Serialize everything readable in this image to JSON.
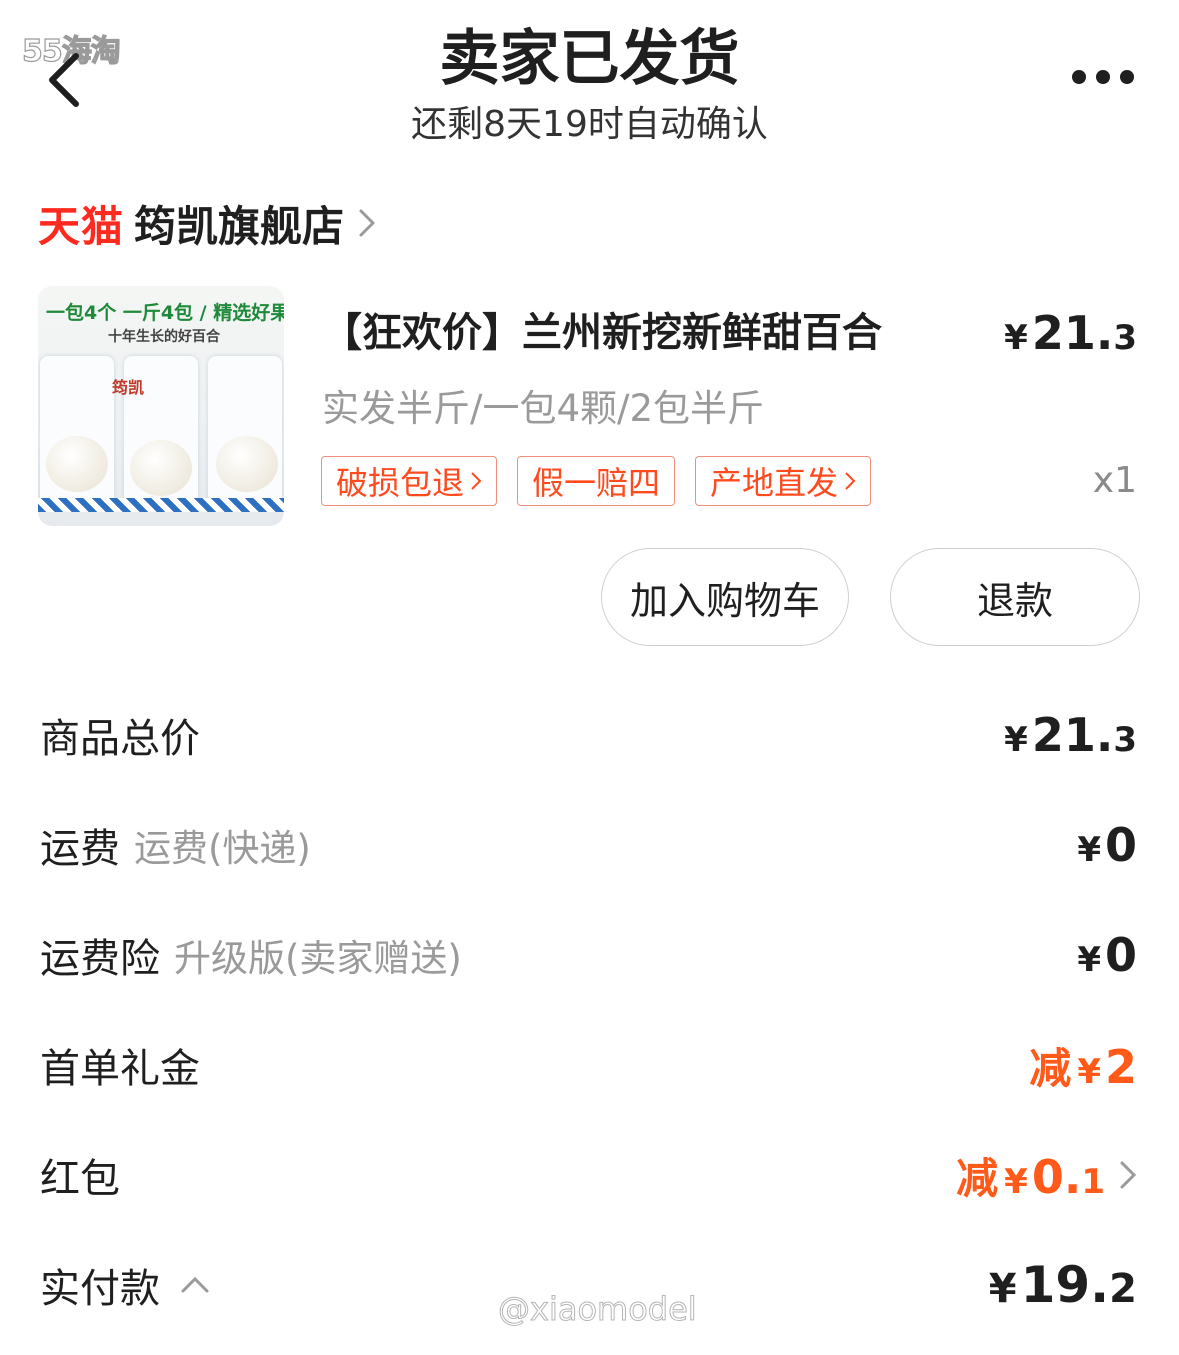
{
  "watermark_top": "55海淘",
  "watermark_bottom": "@xiaomodel",
  "header": {
    "title": "卖家已发货",
    "subtitle": "还剩8天19时自动确认",
    "back_icon": "chevron-left-icon",
    "more_icon": "more-dots-icon"
  },
  "store": {
    "platform": "天猫",
    "name": "筠凯旗舰店"
  },
  "product": {
    "image_text_line1": "一包4个 一斤4包 / 精选好果",
    "image_text_line2": "十年生长的好百合",
    "image_brand": "筠凯",
    "title": "【狂欢价】兰州新挖新鲜甜百合",
    "price_yen": "¥",
    "price_int": "21.",
    "price_dec": "3",
    "spec": "实发半斤/一包4颗/2包半斤",
    "tags": [
      "破损包退",
      "假一赔四",
      "产地直发"
    ],
    "quantity": "x1"
  },
  "actions": {
    "add_to_cart": "加入购物车",
    "refund": "退款"
  },
  "summary": {
    "goods_total": {
      "label": "商品总价",
      "yen": "¥",
      "int": "21.",
      "dec": "3"
    },
    "shipping": {
      "label": "运费",
      "sub": "运费(快递)",
      "yen": "¥",
      "int": "0"
    },
    "shipping_insurance": {
      "label": "运费险",
      "sub": "升级版(卖家赠送)",
      "yen": "¥",
      "int": "0"
    },
    "first_order_gift": {
      "label": "首单礼金",
      "prefix": "减",
      "yen": "¥",
      "int": "2"
    },
    "red_packet": {
      "label": "红包",
      "prefix": "减",
      "yen": "¥",
      "int": "0.",
      "dec": "1"
    },
    "actual_paid": {
      "label": "实付款",
      "yen": "¥",
      "int": "19.",
      "dec": "2"
    }
  },
  "colors": {
    "accent_orange": "#ff5a19",
    "tmall_red": "#ff2a1f",
    "tag_border": "#f0907a"
  }
}
